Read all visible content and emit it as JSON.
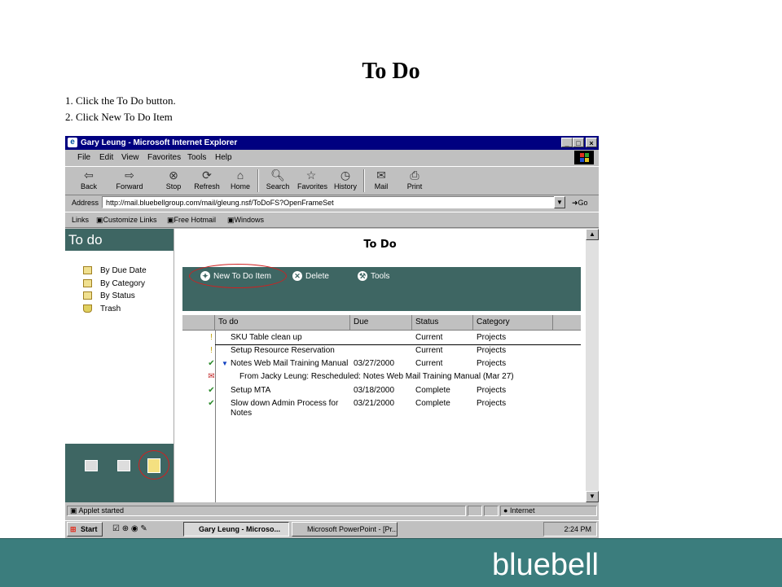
{
  "slide": {
    "title": "To Do",
    "steps": [
      "1.  Click the To Do button.",
      "2.  Click New To Do Item"
    ]
  },
  "browser": {
    "window_title": "Gary Leung - Microsoft Internet Explorer",
    "menu": [
      "File",
      "Edit",
      "View",
      "Favorites",
      "Tools",
      "Help"
    ],
    "toolbar": [
      {
        "label": "Back",
        "icon": "back-arrow-icon"
      },
      {
        "label": "Forward",
        "icon": "forward-arrow-icon"
      },
      {
        "label": "Stop",
        "icon": "stop-icon"
      },
      {
        "label": "Refresh",
        "icon": "refresh-icon"
      },
      {
        "label": "Home",
        "icon": "home-icon"
      },
      {
        "label": "Search",
        "icon": "search-icon"
      },
      {
        "label": "Favorites",
        "icon": "favorites-icon"
      },
      {
        "label": "History",
        "icon": "history-icon"
      },
      {
        "label": "Mail",
        "icon": "mail-icon"
      },
      {
        "label": "Print",
        "icon": "print-icon"
      }
    ],
    "address_label": "Address",
    "address_url": "http://mail.bluebellgroup.com/mail/gleung.nsf/ToDoFS?OpenFrameSet",
    "go_label": "Go",
    "links_label": "Links",
    "links": [
      "Customize Links",
      "Free Hotmail",
      "Windows"
    ],
    "status_text": "Applet started",
    "zone": "Internet"
  },
  "notes_app": {
    "left_title": "To do",
    "nav": [
      "By Due Date",
      "By Category",
      "By Status",
      "Trash"
    ],
    "main_title": "To Do",
    "actions": [
      "New To Do Item",
      "Delete",
      "Tools"
    ],
    "columns": [
      "To do",
      "Due",
      "Status",
      "Category"
    ],
    "rows": [
      {
        "todo": "SKU Table clean up",
        "due": "",
        "status": "Current",
        "category": "Projects",
        "mark": "!"
      },
      {
        "todo": "Setup Resource Reservation",
        "due": "",
        "status": "Current",
        "category": "Projects",
        "mark": "!"
      },
      {
        "todo": "Notes Web Mail Training Manual",
        "due": "03/27/2000",
        "status": "Current",
        "category": "Projects",
        "mark": "✔"
      },
      {
        "todo": "From Jacky Leung:  Rescheduled: Notes Web Mail Training Manual (Mar 27)",
        "due": "",
        "status": "",
        "category": "",
        "mark": "✉"
      },
      {
        "todo": "Setup MTA",
        "due": "03/18/2000",
        "status": "Complete",
        "category": "Projects",
        "mark": "✔"
      },
      {
        "todo": "Slow down Admin Process for",
        "todo2": "Notes",
        "due": "03/21/2000",
        "status": "Complete",
        "category": "Projects",
        "mark": "✔"
      }
    ]
  },
  "taskbar": {
    "start": "Start",
    "tasks": [
      "Gary Leung - Microso...",
      "Microsoft PowerPoint - [Pr..."
    ],
    "clock": "2:24 PM"
  },
  "footer": {
    "brand": "bluebell"
  },
  "colors": {
    "notes_teal": "#3e6663",
    "footer_teal": "#3b7d7d",
    "title_blue": "#000080",
    "highlight_red": "#d02020"
  }
}
